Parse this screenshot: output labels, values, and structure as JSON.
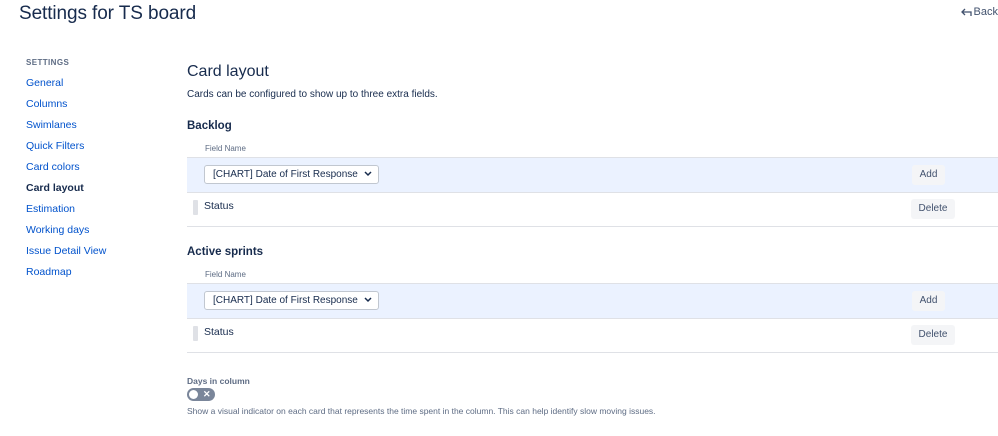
{
  "page": {
    "title": "Settings for TS board",
    "back_label": "Back"
  },
  "sidebar": {
    "heading": "SETTINGS",
    "items": [
      {
        "label": "General"
      },
      {
        "label": "Columns"
      },
      {
        "label": "Swimlanes"
      },
      {
        "label": "Quick Filters"
      },
      {
        "label": "Card colors"
      },
      {
        "label": "Card layout",
        "active": true
      },
      {
        "label": "Estimation"
      },
      {
        "label": "Working days"
      },
      {
        "label": "Issue Detail View"
      },
      {
        "label": "Roadmap"
      }
    ]
  },
  "main": {
    "title": "Card layout",
    "description": "Cards can be configured to show up to three extra fields.",
    "groups": [
      {
        "title": "Backlog",
        "field_header": "Field Name",
        "select_value": "[CHART] Date of First Response",
        "add_label": "Add",
        "fields": [
          {
            "label": "Status",
            "delete_label": "Delete"
          }
        ]
      },
      {
        "title": "Active sprints",
        "field_header": "Field Name",
        "select_value": "[CHART] Date of First Response",
        "add_label": "Add",
        "fields": [
          {
            "label": "Status",
            "delete_label": "Delete"
          }
        ]
      }
    ],
    "days_in_column": {
      "label": "Days in column",
      "enabled": false,
      "description": "Show a visual indicator on each card that represents the time spent in the column. This can help identify slow moving issues."
    }
  },
  "colors": {
    "link": "#0052cc",
    "text": "#172b4d",
    "row_highlight": "#ebf2ff",
    "toggle_off": "#7a869a"
  }
}
